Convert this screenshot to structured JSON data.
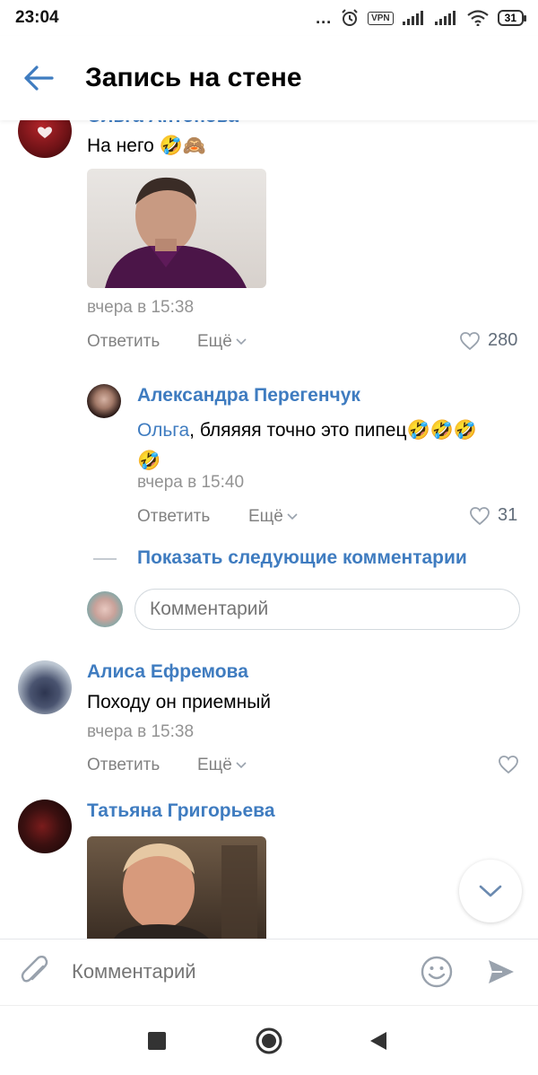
{
  "status_bar": {
    "time": "23:04",
    "dots": "...",
    "vpn": "VPN",
    "battery": "31"
  },
  "header": {
    "title": "Запись на стене"
  },
  "comments": [
    {
      "author": "Ольга Антонова",
      "text": "На него 🤣🙈",
      "date": "вчера в 15:38",
      "reply_label": "Ответить",
      "more_label": "Ещё",
      "likes": "280"
    },
    {
      "author": "Александра Перегенчук",
      "mention": "Ольга",
      "text": ", бляяяя точно это пипец🤣🤣🤣",
      "text_line2": "🤣",
      "date": "вчера в 15:40",
      "reply_label": "Ответить",
      "more_label": "Ещё",
      "likes": "31"
    },
    {
      "author": "Алиса Ефремова",
      "text": "Походу он приемный",
      "date": "вчера в 15:38",
      "reply_label": "Ответить",
      "more_label": "Ещё"
    },
    {
      "author": "Татьяна Григорьева"
    }
  ],
  "thread": {
    "show_more": "Показать следующие комментарии",
    "comment_placeholder": "Комментарий"
  },
  "composer": {
    "placeholder": "Комментарий"
  },
  "colors": {
    "accent": "#3f7cc0",
    "secondary_text": "#939393"
  }
}
